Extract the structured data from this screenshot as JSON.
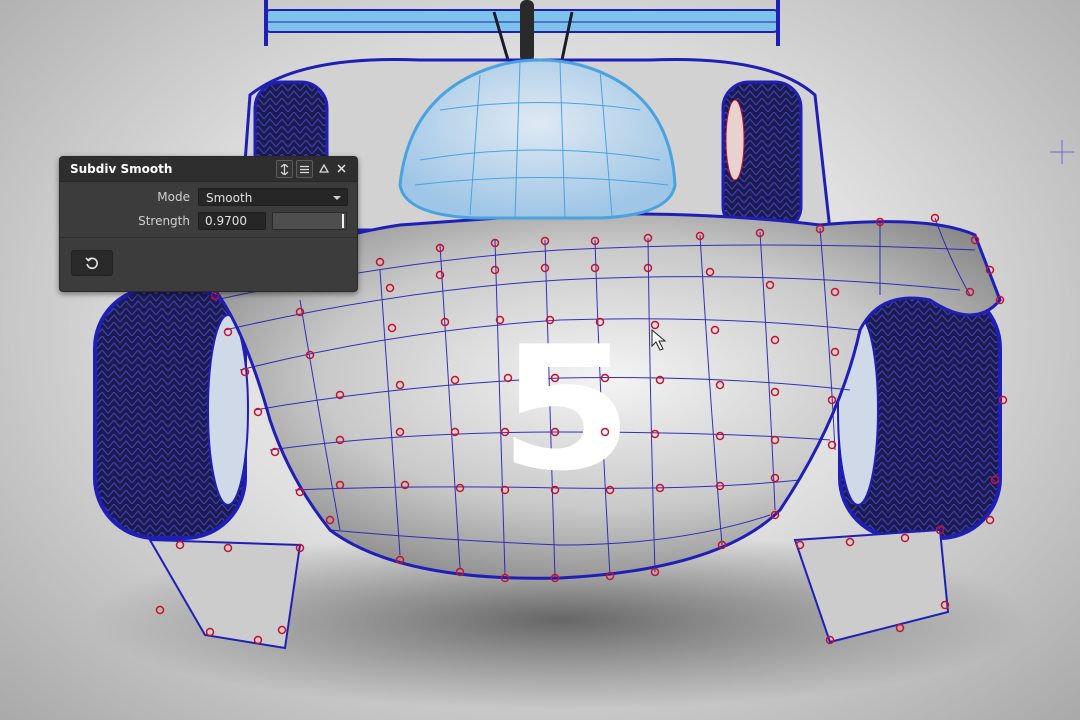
{
  "panel": {
    "title": "Subdiv Smooth",
    "mode_label": "Mode",
    "mode_value": "Smooth",
    "strength_label": "Strength",
    "strength_value": "0.9700",
    "strength_fraction": 0.97,
    "reset_icon": "reset-icon",
    "titlebar_icons": [
      "pin-icon",
      "menu-icon",
      "collapse-icon",
      "close-icon"
    ]
  },
  "viewport": {
    "car_number": "5",
    "wire_color": "#1f1fb8",
    "control_point_color": "#c8102e",
    "canopy_color": "#6fb6e8"
  }
}
